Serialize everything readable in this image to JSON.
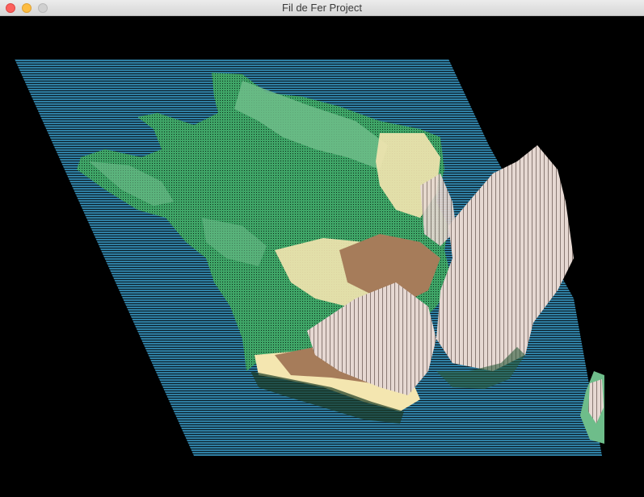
{
  "window": {
    "title": "Fil de Fer Project",
    "controls": {
      "close": {
        "icon": "close-icon",
        "color": "#fc615d"
      },
      "minimize": {
        "icon": "minimize-icon",
        "color": "#fdbc40"
      },
      "zoom": {
        "icon": "zoom-icon",
        "color": "#d0d0d0"
      }
    }
  },
  "scene": {
    "background": "#000000",
    "palette": {
      "water": "#2f7fa3",
      "lowland": "#3fa567",
      "plains": "#6ebd8a",
      "hills": "#f4e6b0",
      "mountains": "#a67c5a",
      "peaks": "#e6d8d2"
    }
  }
}
